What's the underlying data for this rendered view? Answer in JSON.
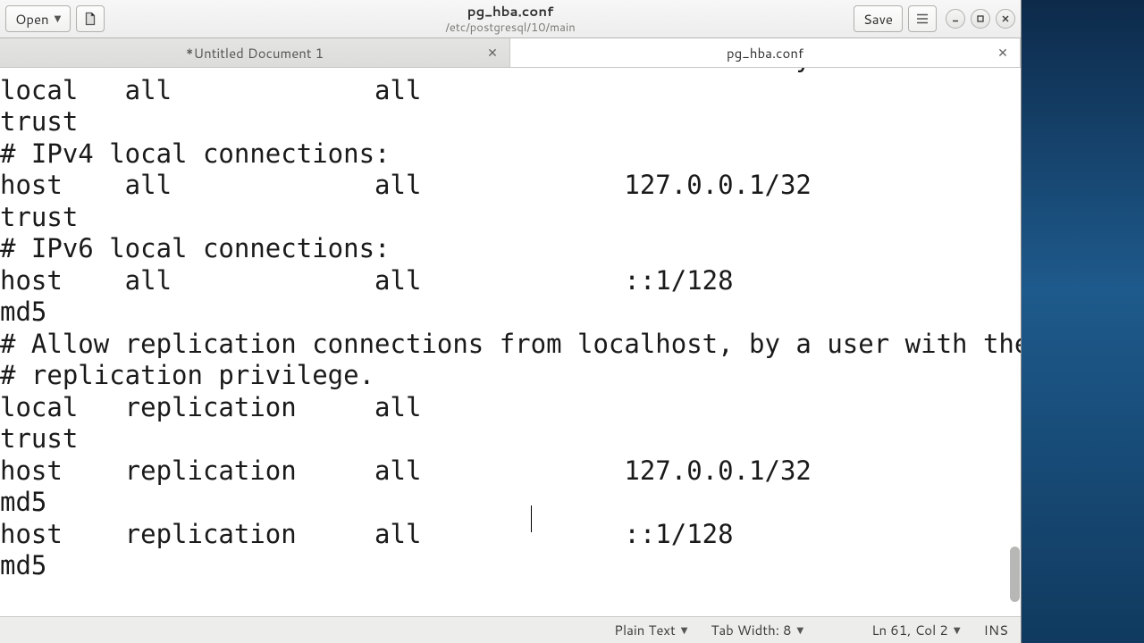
{
  "header": {
    "open_label": "Open",
    "save_label": "Save",
    "title": "pg_hba.conf",
    "subtitle": "/etc/postgresql/10/main"
  },
  "tabs": [
    {
      "label": "*Untitled Document 1",
      "active": false
    },
    {
      "label": "pg_hba.conf",
      "active": true
    }
  ],
  "editor": {
    "content": "#  local  is for Unix domain socket connections only\nlocal   all             all                                     \ntrust\n# IPv4 local connections:\nhost    all             all             127.0.0.1/32            \ntrust\n# IPv6 local connections:\nhost    all             all             ::1/128                 \nmd5\n# Allow replication connections from localhost, by a user with the\n# replication privilege.\nlocal   replication     all                                     \ntrust\nhost    replication     all             127.0.0.1/32            \nmd5\nhost    replication     all             ::1/128                 \nmd5"
  },
  "status": {
    "syntax": "Plain Text",
    "tabwidth": "Tab Width: 8",
    "position": "Ln 61, Col 2",
    "insert_mode": "INS"
  }
}
